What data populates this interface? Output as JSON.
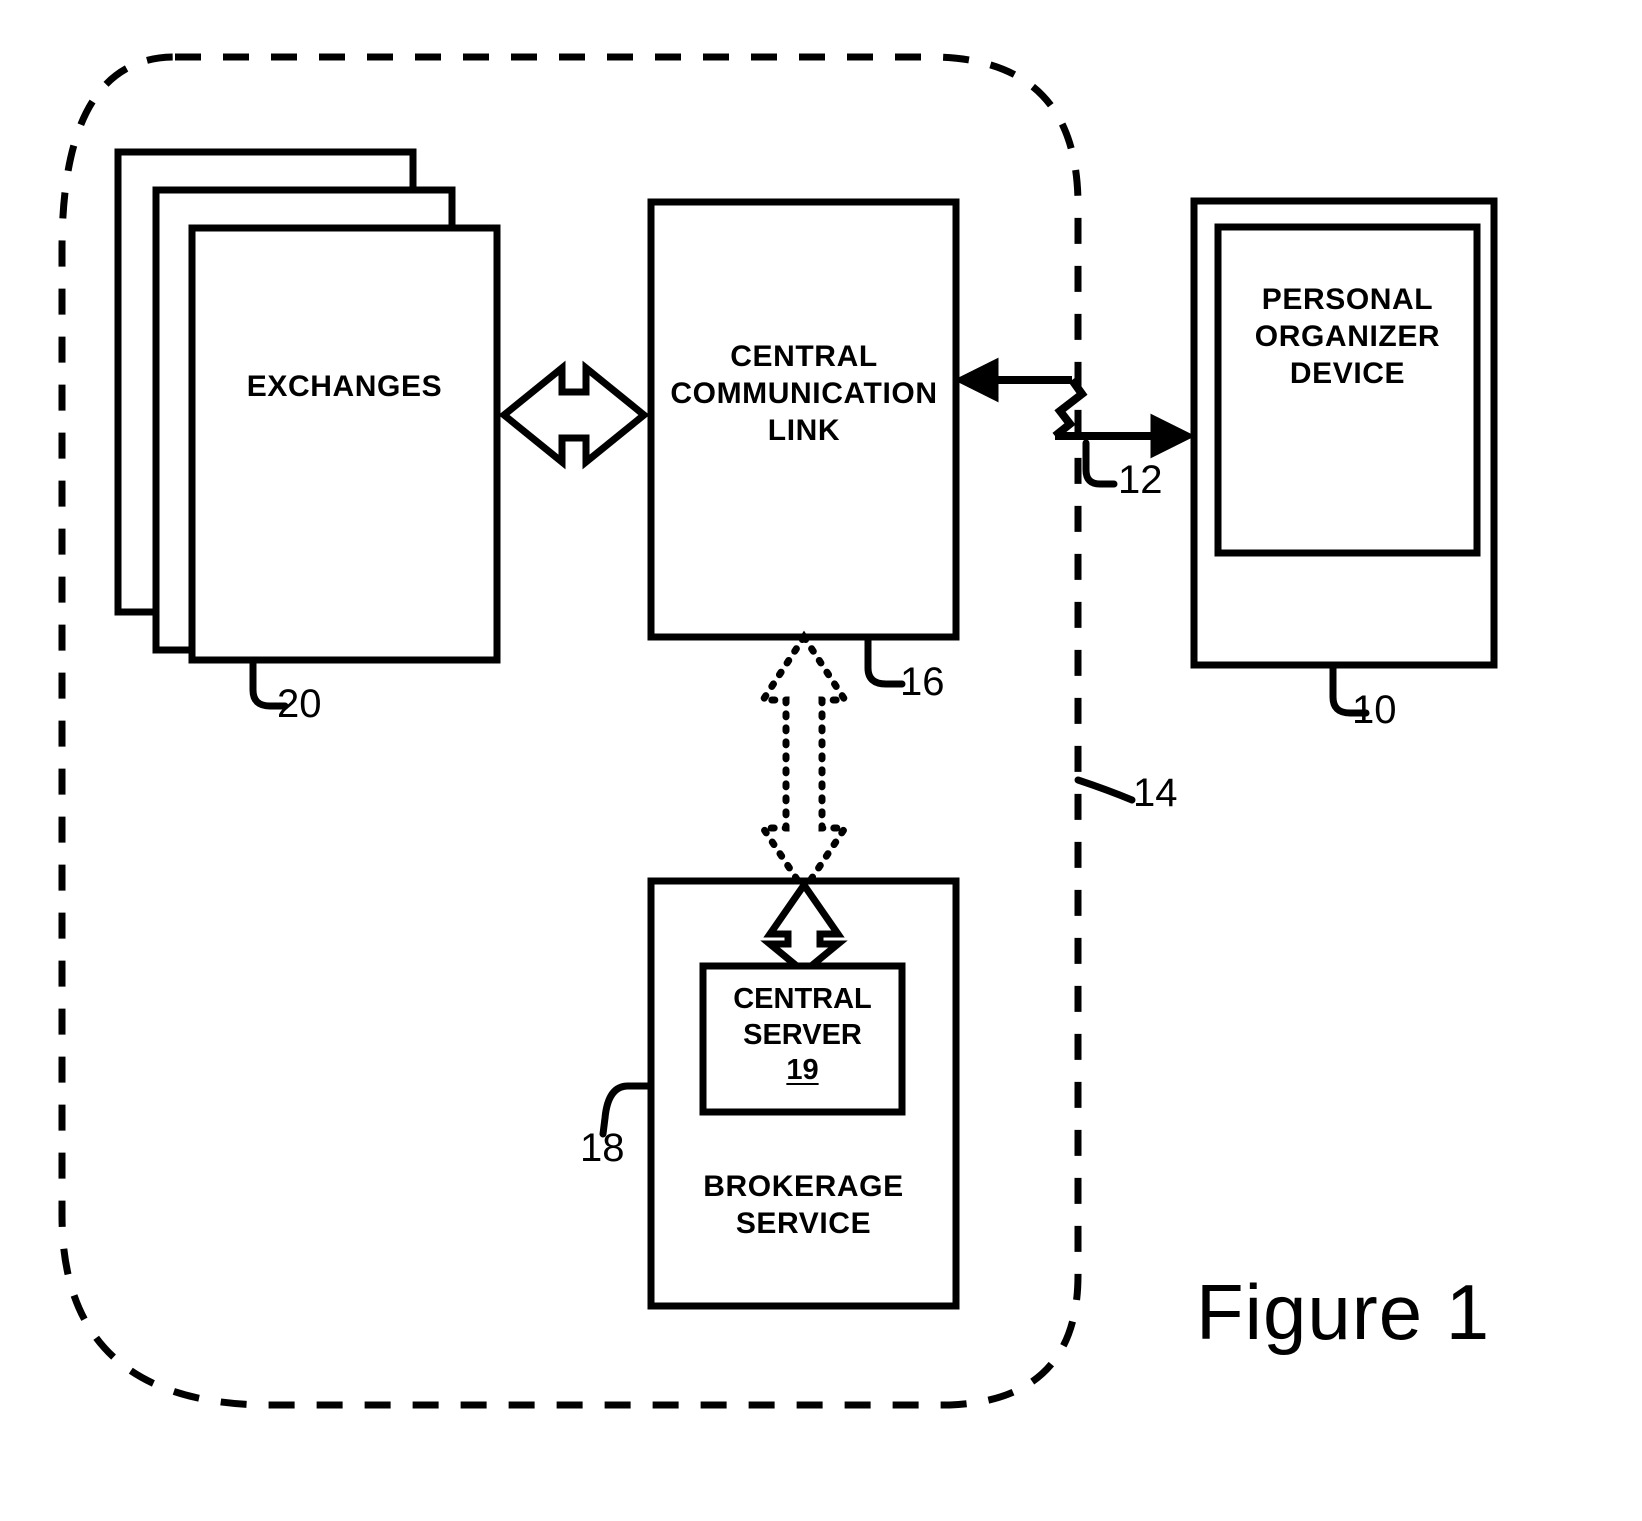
{
  "figure": {
    "caption": "Figure 1",
    "boundary_label": "14"
  },
  "blocks": {
    "exchanges": {
      "label": "EXCHANGES",
      "ref": "20"
    },
    "central_link": {
      "label": "CENTRAL\nCOMMUNICATION\nLINK",
      "ref": "16"
    },
    "personal_organizer": {
      "label": "PERSONAL\nORGANIZER\nDEVICE",
      "ref": "10"
    },
    "brokerage": {
      "label": "BROKERAGE\nSERVICE",
      "ref": "18"
    },
    "central_server": {
      "label": "CENTRAL\nSERVER",
      "ref": "19"
    }
  },
  "connectors": {
    "exchanges_link": {
      "name": "bidirectional-hollow-arrow",
      "style": "hollow-double-headed"
    },
    "wireless_link": {
      "name": "wireless-zigzag-link",
      "ref": "12",
      "style": "lightning-bolt"
    },
    "link_brokerage_dotted": {
      "name": "dotted-bidirectional-arrow",
      "style": "dotted-outline-double-headed"
    },
    "brokerage_server": {
      "name": "hollow-vertical-double-arrow",
      "style": "hollow-double-headed-vertical"
    }
  },
  "colors": {
    "stroke": "#000000",
    "fill": "#ffffff",
    "background": "#ffffff"
  }
}
